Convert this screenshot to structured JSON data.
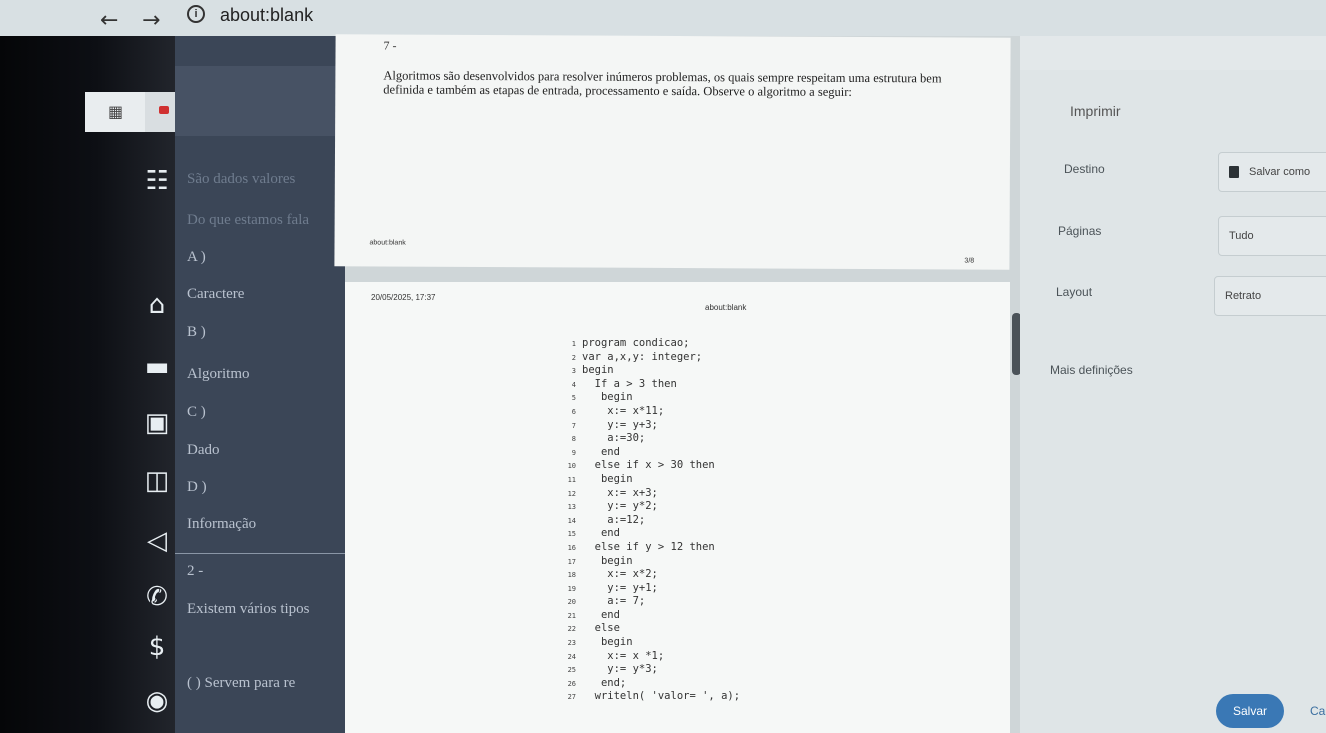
{
  "browser": {
    "back_icon": "←",
    "forward_icon": "→",
    "info_icon": "i",
    "url": "about:blank"
  },
  "left_icons": [
    "apps-icon",
    "menu-grid-icon",
    "home-icon",
    "graduation-cap-icon",
    "briefcase-icon",
    "book-icon",
    "megaphone-icon",
    "phone-icon",
    "dollar-icon",
    "chat-icon"
  ],
  "quiz": {
    "line1": "São dados valores",
    "line2": "Do que estamos fala",
    "option_a": "A )",
    "answer_a": "Caractere",
    "option_b": "B )",
    "answer_b": "Algoritmo",
    "option_c": "C )",
    "answer_c": "Dado",
    "option_d": "D )",
    "answer_d": "Informação",
    "q2_number": "2 -",
    "q2_text": "Existem vários tipos",
    "q2_item": "(    ) Servem para re"
  },
  "page1": {
    "question_number": "7 -",
    "text": "Algoritmos são desenvolvidos para resolver inúmeros problemas, os quais sempre respeitam uma estrutura bem definida e também as etapas de entrada, processamento e saída. Observe o algoritmo a seguir:",
    "footer_url": "about:blank",
    "footer_page": "3/8"
  },
  "page2": {
    "date": "20/05/2025, 17:37",
    "header_url": "about:blank",
    "code": [
      {
        "n": "1",
        "t": "program condicao;"
      },
      {
        "n": "2",
        "t": "var a,x,y: integer;"
      },
      {
        "n": "3",
        "t": "begin"
      },
      {
        "n": "4",
        "t": "  If a > 3 then"
      },
      {
        "n": "5",
        "t": "   begin"
      },
      {
        "n": "6",
        "t": "    x:= x*11;"
      },
      {
        "n": "7",
        "t": "    y:= y+3;"
      },
      {
        "n": "8",
        "t": "    a:=30;"
      },
      {
        "n": "9",
        "t": "   end"
      },
      {
        "n": "10",
        "t": "  else if x > 30 then"
      },
      {
        "n": "11",
        "t": "   begin"
      },
      {
        "n": "12",
        "t": "    x:= x+3;"
      },
      {
        "n": "13",
        "t": "    y:= y*2;"
      },
      {
        "n": "14",
        "t": "    a:=12;"
      },
      {
        "n": "15",
        "t": "   end"
      },
      {
        "n": "16",
        "t": "  else if y > 12 then"
      },
      {
        "n": "17",
        "t": "   begin"
      },
      {
        "n": "18",
        "t": "    x:= x*2;"
      },
      {
        "n": "19",
        "t": "    y:= y+1;"
      },
      {
        "n": "20",
        "t": "    a:= 7;"
      },
      {
        "n": "21",
        "t": "   end"
      },
      {
        "n": "22",
        "t": "  else"
      },
      {
        "n": "23",
        "t": "   begin"
      },
      {
        "n": "24",
        "t": "    x:= x *1;"
      },
      {
        "n": "25",
        "t": "    y:= y*3;"
      },
      {
        "n": "26",
        "t": "   end;"
      },
      {
        "n": "27",
        "t": "  writeln( 'valor= ', a);"
      }
    ]
  },
  "print_dialog": {
    "title": "Imprimir",
    "destination_label": "Destino",
    "destination_value": "Salvar como",
    "pages_label": "Páginas",
    "pages_value": "Tudo",
    "layout_label": "Layout",
    "layout_value": "Retrato",
    "more_settings": "Mais definições",
    "save_button": "Salvar",
    "cancel_button": "Ca"
  }
}
